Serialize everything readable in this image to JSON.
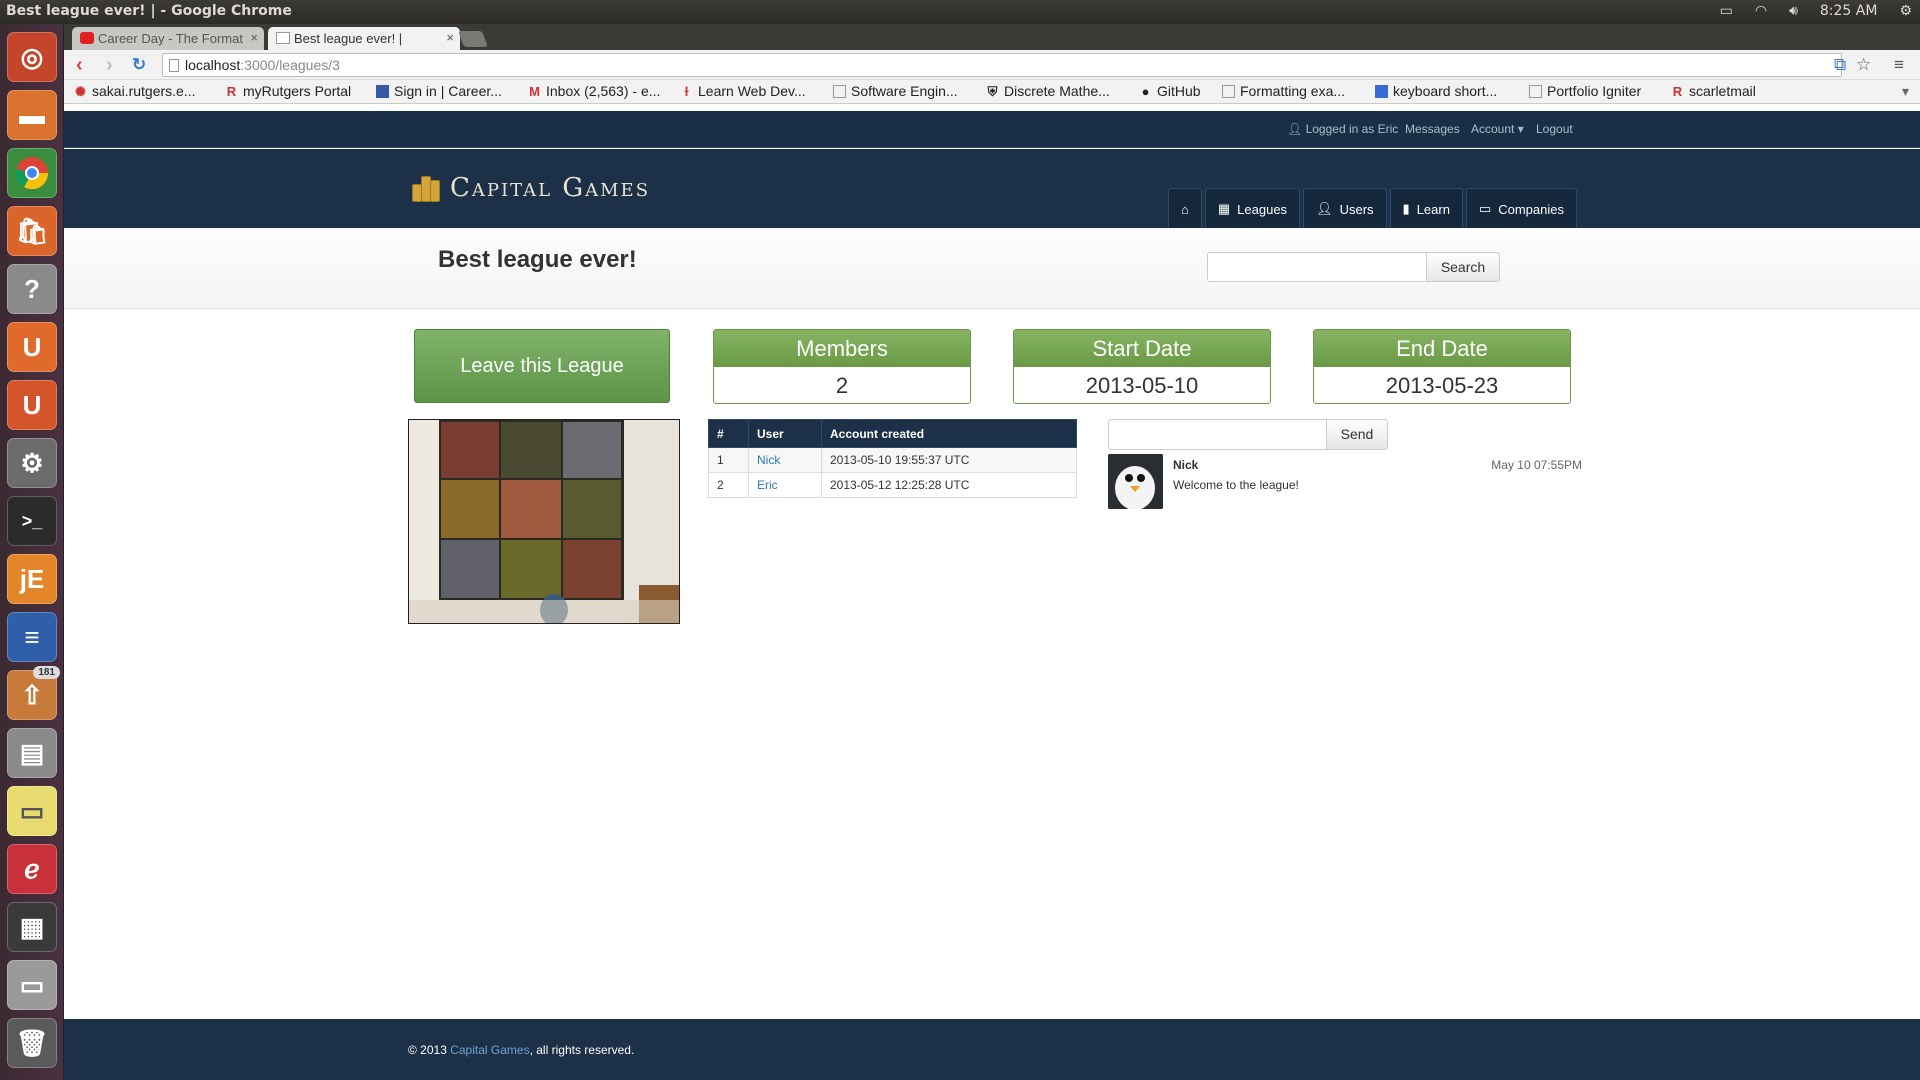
{
  "os_panel": {
    "window_title": "Best league ever! | - Google Chrome",
    "clock": "8:25 AM"
  },
  "launcher": {
    "badge_count": "181",
    "items": [
      "ubuntu-dash",
      "files",
      "chrome",
      "software-center",
      "help",
      "ubuntu-one",
      "ubuntu-one-alt",
      "system-settings",
      "terminal",
      "jedit",
      "libreoffice-writer",
      "archive-manager",
      "scanner",
      "sticky-notes",
      "evince",
      "workspace-switcher",
      "drive",
      "trash"
    ]
  },
  "browser": {
    "tabs": [
      {
        "title": "Career Day - The Format",
        "active": false
      },
      {
        "title": "Best league ever! |",
        "active": true
      }
    ],
    "url_host": "localhost",
    "url_path": ":3000/leagues/3",
    "bookmarks": [
      "sakai.rutgers.e...",
      "myRutgers Portal",
      "Sign in | Career...",
      "Inbox (2,563) - e...",
      "Learn Web Dev...",
      "Software Engin...",
      "Discrete Mathe...",
      "GitHub",
      "Formatting exa...",
      "keyboard short...",
      "Portfolio Igniter",
      "scarletmail"
    ]
  },
  "userbar": {
    "logged_in": "Logged in as Eric",
    "messages": "Messages",
    "account": "Account",
    "logout": "Logout"
  },
  "site": {
    "brand": "Capital Games",
    "nav": [
      "Leagues",
      "Users",
      "Learn",
      "Companies"
    ]
  },
  "league": {
    "title": "Best league ever!",
    "search_button": "Search",
    "leave_button": "Leave this League",
    "stats": [
      {
        "label": "Members",
        "value": "2"
      },
      {
        "label": "Start Date",
        "value": "2013-05-10"
      },
      {
        "label": "End Date",
        "value": "2013-05-23"
      }
    ]
  },
  "members_table": {
    "headers": [
      "#",
      "User",
      "Account created"
    ],
    "rows": [
      [
        "1",
        "Nick",
        "2013-05-10 19:55:37 UTC"
      ],
      [
        "2",
        "Eric",
        "2013-05-12 12:25:28 UTC"
      ]
    ]
  },
  "chat": {
    "send_button": "Send",
    "messages": [
      {
        "sender": "Nick",
        "text": "Welcome to the league!",
        "time": "May 10 07:55PM"
      }
    ]
  },
  "footer": {
    "prefix": "© 2013 ",
    "brand": "Capital Games",
    "suffix": ", all rights reserved."
  }
}
